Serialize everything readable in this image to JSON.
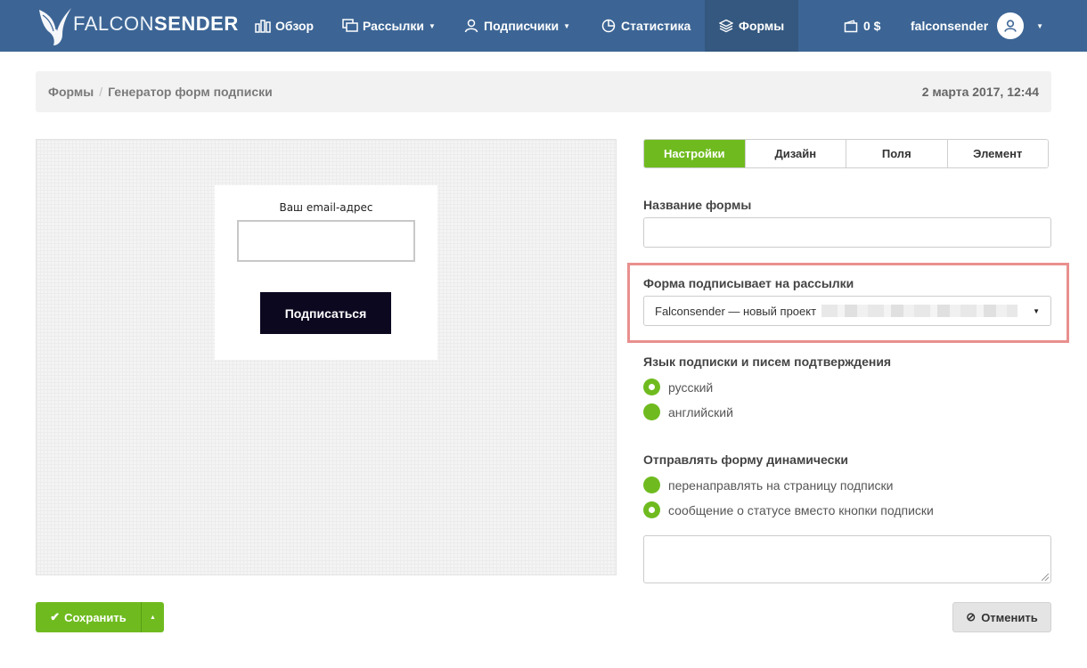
{
  "brand": {
    "name_thin": "FALCON",
    "name_bold": "SENDER"
  },
  "nav": {
    "overview": "Обзор",
    "mailings": "Рассылки",
    "subscribers": "Подписчики",
    "stats": "Статистика",
    "forms": "Формы",
    "balance": "0 $",
    "user": "falconsender"
  },
  "breadcrumb": {
    "parent": "Формы",
    "separator": "/",
    "current": "Генератор форм подписки",
    "date": "2 марта 2017, 12:44"
  },
  "preview": {
    "email_label": "Ваш email-адрес",
    "submit_label": "Подписаться"
  },
  "tabs": [
    {
      "label": "Настройки",
      "active": true
    },
    {
      "label": "Дизайн",
      "active": false
    },
    {
      "label": "Поля",
      "active": false
    },
    {
      "label": "Элемент",
      "active": false
    }
  ],
  "settings": {
    "form_name_label": "Название формы",
    "form_name_value": "",
    "list_label": "Форма подписывает на рассылки",
    "list_selected": "Falconsender — новый проект",
    "language_label": "Язык подписки и писем подтверждения",
    "language_options": [
      {
        "label": "русский",
        "checked": true
      },
      {
        "label": "английский",
        "checked": false
      }
    ],
    "dynamic_label": "Отправлять форму динамически",
    "dynamic_options": [
      {
        "label": "перенаправлять на страницу подписки",
        "checked": false
      },
      {
        "label": "сообщение о статусе вместо кнопки подписки",
        "checked": true
      }
    ],
    "message_value": ""
  },
  "actions": {
    "save_label": "Сохранить",
    "cancel_label": "Отменить"
  },
  "colors": {
    "navbar": "#3c6595",
    "accent_green": "#6fbb1f",
    "highlight_border": "#e8908e",
    "subscribe_button": "#0b0820"
  }
}
